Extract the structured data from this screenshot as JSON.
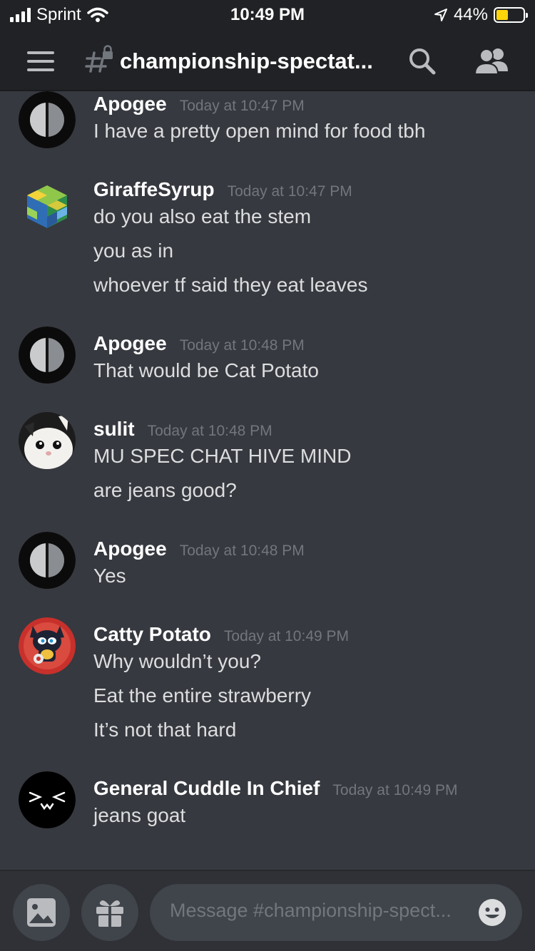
{
  "status": {
    "carrier": "Sprint",
    "time": "10:49 PM",
    "battery": "44%",
    "battery_level": 0.44
  },
  "header": {
    "channel": "championship-spectat..."
  },
  "messages": [
    {
      "author": "Apogee",
      "time": "Today at 10:47 PM",
      "avatar": "moon-avatar",
      "lines": [
        "I have a pretty open mind for food tbh"
      ]
    },
    {
      "author": "GiraffeSyrup",
      "time": "Today at 10:47 PM",
      "avatar": "cube-avatar",
      "lines": [
        "do you also eat the stem",
        "you as in",
        "whoever tf said they eat leaves"
      ]
    },
    {
      "author": "Apogee",
      "time": "Today at 10:48 PM",
      "avatar": "moon-avatar",
      "lines": [
        "That would be Cat Potato"
      ]
    },
    {
      "author": "sulit",
      "time": "Today at 10:48 PM",
      "avatar": "cat-photo-avatar",
      "lines": [
        "MU SPEC CHAT HIVE MIND",
        "are jeans good?"
      ]
    },
    {
      "author": "Apogee",
      "time": "Today at 10:48 PM",
      "avatar": "moon-avatar",
      "lines": [
        "Yes"
      ]
    },
    {
      "author": "Catty Potato",
      "time": "Today at 10:49 PM",
      "avatar": "cartoon-cat-avatar",
      "lines": [
        "Why wouldn’t you?",
        "Eat the entire strawberry",
        "It’s not that hard"
      ]
    },
    {
      "author": "General Cuddle In Chief",
      "time": "Today at 10:49 PM",
      "avatar": "face-avatar",
      "lines": [
        "jeans goat"
      ]
    }
  ],
  "composer": {
    "placeholder": "Message #championship-spect..."
  }
}
